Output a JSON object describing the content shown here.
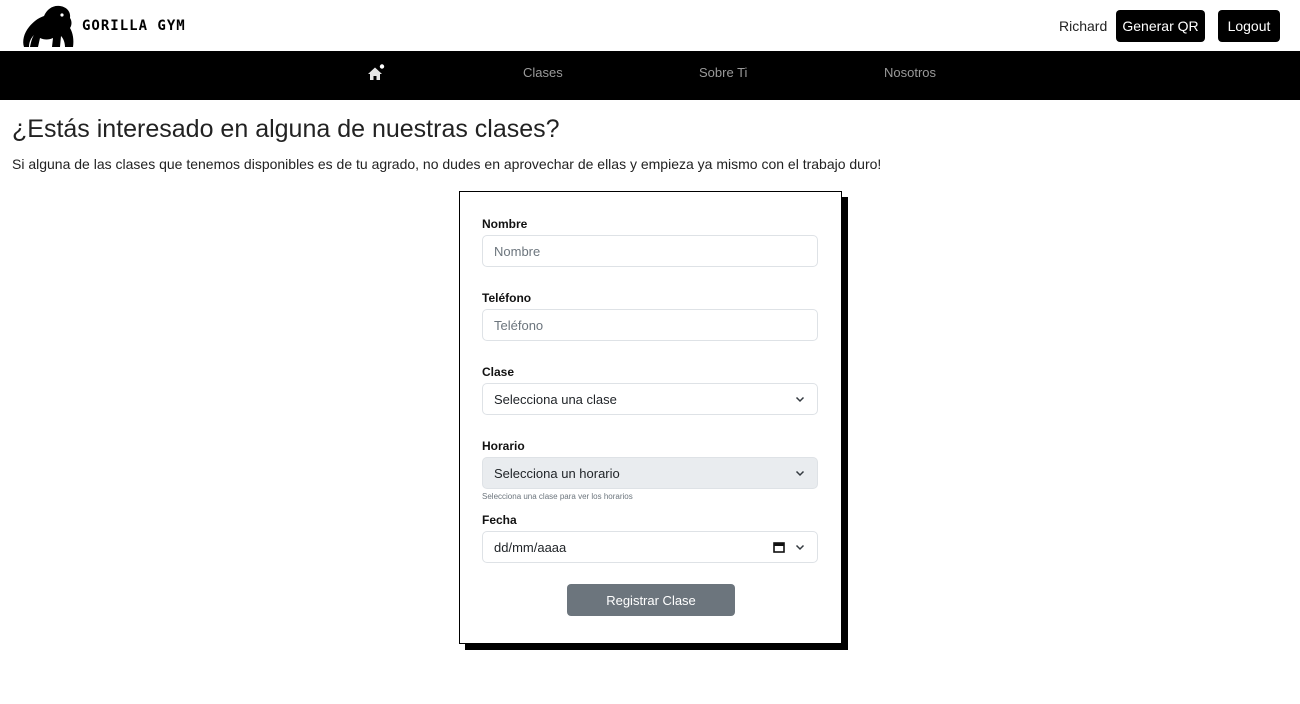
{
  "header": {
    "brand": "GORILLA GYM",
    "logo_icon": "gorilla-icon",
    "user_name": "Richard",
    "qr_button": "Generar QR",
    "logout_button": "Logout"
  },
  "nav": {
    "home_icon": "home-icon",
    "items": [
      "Clases",
      "Sobre Ti",
      "Nosotros"
    ]
  },
  "main": {
    "title": "¿Estás interesado en alguna de nuestras clases?",
    "subtitle": "Si alguna de las clases que tenemos disponibles es de tu agrado, no dudes en aprovechar de ellas y empieza ya mismo con el trabajo duro!"
  },
  "form": {
    "nombre_label": "Nombre",
    "nombre_placeholder": "Nombre",
    "telefono_label": "Teléfono",
    "telefono_placeholder": "Teléfono",
    "clase_label": "Clase",
    "clase_value": "Selecciona una clase",
    "horario_label": "Horario",
    "horario_value": "Selecciona un horario",
    "horario_hint": "Selecciona una clase para ver los horarios",
    "fecha_label": "Fecha",
    "fecha_placeholder": "dd/mm/aaaa",
    "submit_label": "Registrar Clase"
  },
  "colors": {
    "nav_bg": "#000000",
    "button_dark": "#000000",
    "submit_bg": "#6c757d",
    "disabled_field_bg": "#e9ecef"
  }
}
